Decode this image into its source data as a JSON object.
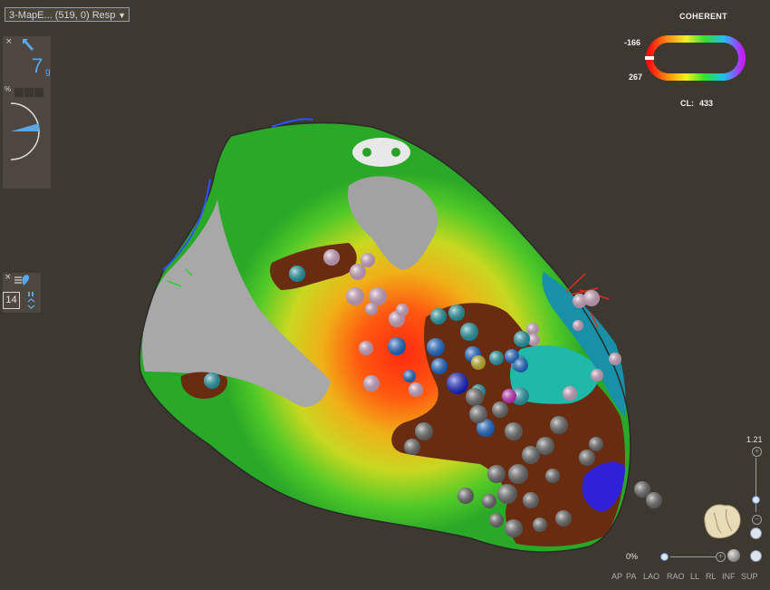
{
  "map_selector": {
    "value": "3-MapE... (519, 0) Resp"
  },
  "left_panel_top": {
    "close": "×",
    "count": "7",
    "unit": "g",
    "percent_label": "%"
  },
  "left_panel_mid": {
    "close": "×",
    "value": "14"
  },
  "colorbar": {
    "title": "COHERENT",
    "max_label": "-166",
    "min_label": "267",
    "cl_label": "CL:",
    "cl_value": "433"
  },
  "zoom": {
    "value": "1.21"
  },
  "opacity": {
    "value": "0%"
  },
  "views": [
    "AP",
    "PA",
    "LAO",
    "RAO",
    "LL",
    "RL",
    "INF",
    "SUP"
  ],
  "colors": {
    "background": "#3d3830",
    "panel": "#4d4740",
    "accent_blue": "#5aa8e8"
  }
}
